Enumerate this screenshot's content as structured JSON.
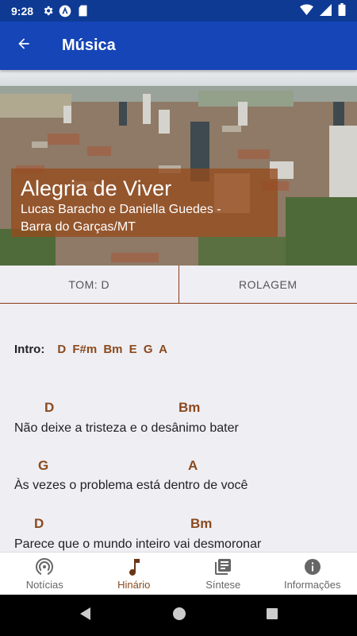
{
  "status": {
    "time": "9:28"
  },
  "app_bar": {
    "title": "Música",
    "back_icon": "arrow-back-icon"
  },
  "song": {
    "title": "Alegria de Viver",
    "artist_line1": "Lucas Baracho e Daniella Guedes -",
    "artist_line2": "Barra do Garças/MT"
  },
  "tabs": {
    "tom": "TOM: D",
    "rolagem": "ROLAGEM"
  },
  "intro": {
    "label": "Intro:",
    "chords": "D  F#m  Bm  E  G  A"
  },
  "verses": [
    {
      "chord_a": "D",
      "chord_b": "Bm",
      "lyric": "Não deixe a tristeza e o desânimo bater"
    },
    {
      "chord_a": "G",
      "chord_b": "A",
      "lyric": "Às vezes o problema está dentro de você"
    },
    {
      "chord_a": "D",
      "chord_b": "Bm",
      "lyric": "Parece que o mundo inteiro vai desmoronar"
    }
  ],
  "bottom_nav": [
    {
      "label": "Notícias",
      "icon": "broadcast-icon"
    },
    {
      "label": "Hinário",
      "icon": "music-note-icon"
    },
    {
      "label": "Síntese",
      "icon": "library-books-icon"
    },
    {
      "label": "Informações",
      "icon": "info-icon"
    }
  ],
  "colors": {
    "status_bar": "#0e3a94",
    "app_bar": "#1545b7",
    "accent": "#8a4a1e",
    "caption_bg": "#964b1e"
  }
}
